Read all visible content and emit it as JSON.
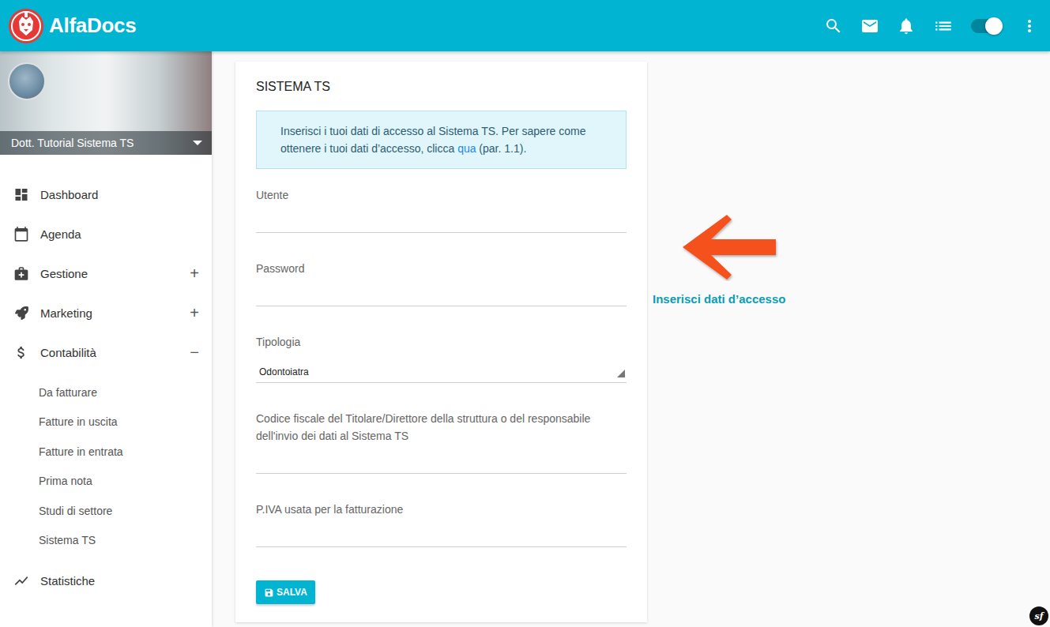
{
  "header": {
    "brand": "AlfaDocs",
    "toggle_on": true
  },
  "profile": {
    "name": "Dott. Tutorial Sistema TS"
  },
  "sidebar": {
    "items": [
      {
        "label": "Dashboard",
        "icon": "dashboard",
        "expander": "",
        "expanded": false,
        "children": []
      },
      {
        "label": "Agenda",
        "icon": "calendar",
        "expander": "",
        "expanded": false,
        "children": []
      },
      {
        "label": "Gestione",
        "icon": "medical",
        "expander": "+",
        "expanded": false,
        "children": []
      },
      {
        "label": "Marketing",
        "icon": "rocket",
        "expander": "+",
        "expanded": false,
        "children": []
      },
      {
        "label": "Contabilità",
        "icon": "dollar",
        "expander": "−",
        "expanded": true,
        "children": [
          "Da fatturare",
          "Fatture in uscita",
          "Fatture in entrata",
          "Prima nota",
          "Studi di settore",
          "Sistema TS"
        ]
      },
      {
        "label": "Statistiche",
        "icon": "chart",
        "expander": "",
        "expanded": false,
        "children": []
      }
    ]
  },
  "form": {
    "title": "SISTEMA TS",
    "info": {
      "before": "Inserisci i tuoi dati di accesso al Sistema TS. Per sapere come ottenere i tuoi dati d’accesso, clicca ",
      "link": "qua",
      "after": " (par. 1.1)."
    },
    "fields": [
      {
        "label": "Utente",
        "kind": "text",
        "value": ""
      },
      {
        "label": "Password",
        "kind": "text",
        "value": ""
      },
      {
        "label": "Tipologia",
        "kind": "select",
        "value": "Odontoiatra"
      },
      {
        "label": "Codice fiscale del Titolare/Direttore della struttura o del responsabile dell'invio dei dati al Sistema TS",
        "kind": "text",
        "value": ""
      },
      {
        "label": "P.IVA usata per la fatturazione",
        "kind": "text",
        "value": ""
      }
    ],
    "save_button": "SALVA"
  },
  "annotation": {
    "text": "Inserisci dati d’accesso"
  },
  "corner_badge": "sf"
}
